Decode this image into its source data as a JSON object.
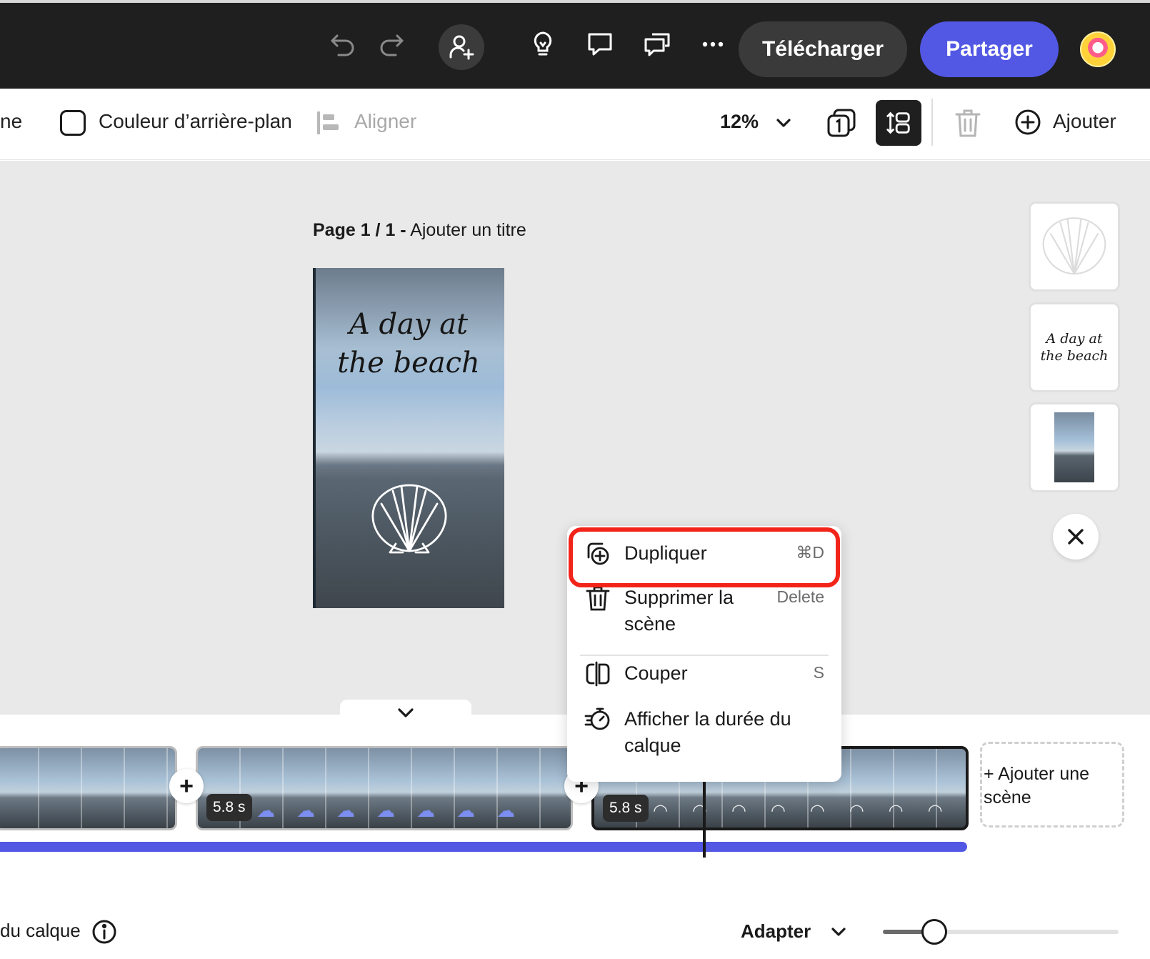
{
  "topbar": {
    "undo_icon": "undo-icon",
    "redo_icon": "redo-icon",
    "invite_icon": "person-add-icon",
    "download_label": "Télécharger",
    "share_label": "Partager"
  },
  "toolbar": {
    "left_cut": "ne",
    "bg_color_label": "Couleur d’arrière-plan",
    "align_label": "Aligner",
    "zoom": "12%",
    "add_label": "Ajouter"
  },
  "canvas": {
    "page_number": "Page 1 / 1 -",
    "page_title": "Ajouter un titre",
    "artboard_title_line1": "A day at",
    "artboard_title_line2": "the beach"
  },
  "thumbs": {
    "text_line1": "A day at",
    "text_line2": "the beach"
  },
  "context_menu": {
    "items": [
      {
        "label": "Dupliquer",
        "shortcut": "⌘D",
        "icon": "duplicate-icon"
      },
      {
        "label": "Supprimer la scène",
        "shortcut": "Delete",
        "icon": "trash-icon"
      },
      {
        "label": "Couper",
        "shortcut": "S",
        "icon": "split-icon"
      },
      {
        "label": "Afficher la durée du calque",
        "shortcut": "",
        "icon": "timer-icon"
      }
    ]
  },
  "timeline": {
    "clip2_duration": "5.8 s",
    "clip3_duration": "5.8 s",
    "add_scene_label": "+ Ajouter une scène",
    "bottom_left_label": "du calque",
    "fit_label": "Adapter",
    "accent": "#5258e4"
  },
  "colors": {
    "topbar_bg": "#1f1f1f",
    "share_btn": "#5258e4",
    "highlight": "#f2241a"
  }
}
